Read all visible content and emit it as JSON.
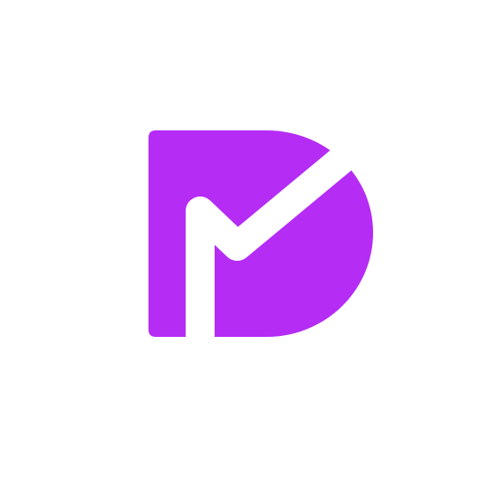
{
  "logo": {
    "icon": "d-checkmark-logo-icon",
    "brand_color": "#B52CF5",
    "background_color": "#FFFFFF"
  }
}
